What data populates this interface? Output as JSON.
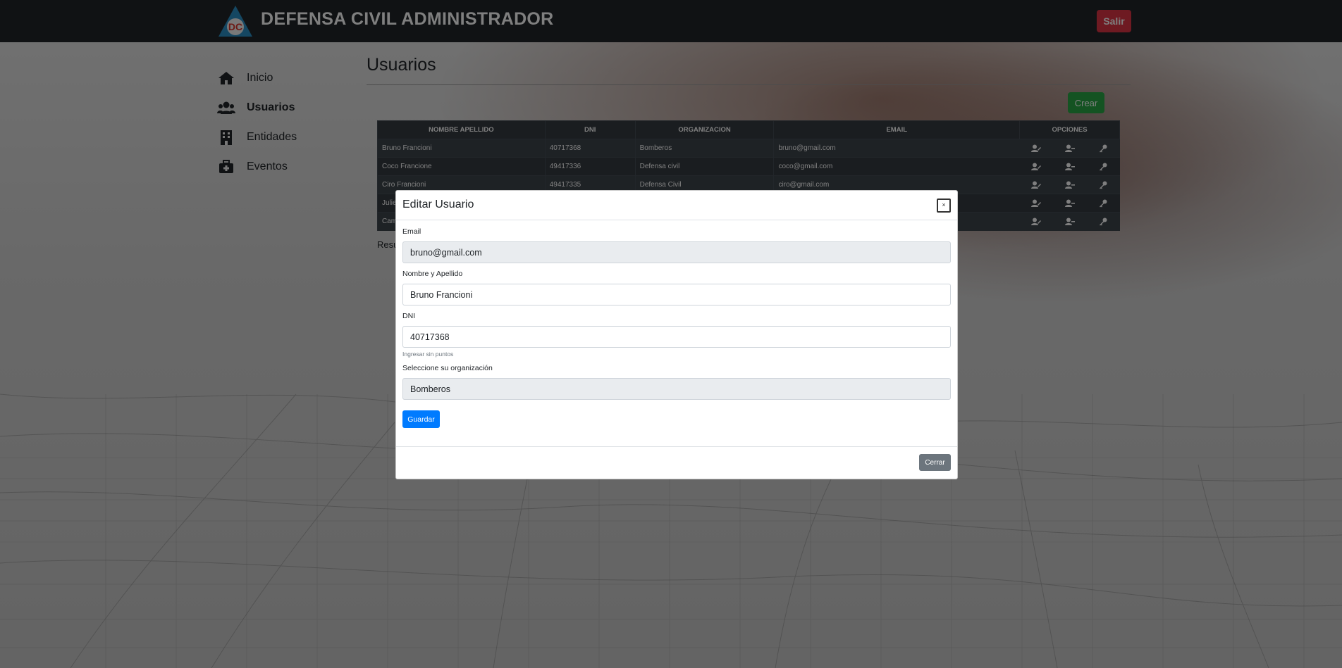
{
  "app": {
    "brand": "DEFENSA CIVIL ADMINISTRADOR",
    "logo_text": "DC",
    "logout_label": "Salir"
  },
  "sidebar": {
    "items": [
      {
        "label": "Inicio",
        "icon": "home-icon"
      },
      {
        "label": "Usuarios",
        "icon": "users-icon",
        "active": true
      },
      {
        "label": "Entidades",
        "icon": "building-icon"
      },
      {
        "label": "Eventos",
        "icon": "first-aid-icon"
      }
    ]
  },
  "main": {
    "title": "Usuarios",
    "create_label": "Crear",
    "results_text": "Resu",
    "table": {
      "headers": [
        "NOMBRE APELLIDO",
        "DNI",
        "ORGANIZACION",
        "EMAIL",
        "OPCIONES"
      ],
      "rows": [
        {
          "name": "Bruno Francioni",
          "dni": "40717368",
          "org": "Bomberos",
          "email": "bruno@gmail.com"
        },
        {
          "name": "Coco Francione",
          "dni": "49417336",
          "org": "Defensa civil",
          "email": "coco@gmail.com"
        },
        {
          "name": "Ciro Francioni",
          "dni": "49417335",
          "org": "Defensa Civil",
          "email": "ciro@gmail.com"
        },
        {
          "name": "Julie",
          "dni": "",
          "org": "",
          "email": ""
        },
        {
          "name": "Cam",
          "dni": "",
          "org": "",
          "email": ""
        }
      ]
    }
  },
  "modal": {
    "title": "Editar Usuario",
    "close_symbol": "×",
    "fields": {
      "email_label": "Email",
      "email_value": "bruno@gmail.com",
      "name_label": "Nombre y Apellido",
      "name_value": "Bruno Francioni",
      "dni_label": "DNI",
      "dni_value": "40717368",
      "dni_help": "Ingresar sin puntos",
      "org_label": "Seleccione su organización",
      "org_value": "Bomberos"
    },
    "save_label": "Guardar",
    "close_label": "Cerrar"
  },
  "colors": {
    "navbar": "#212529",
    "danger": "#dc3545",
    "success": "#28a745",
    "primary": "#007bff",
    "secondary": "#6c757d",
    "logo_blue": "#2b8fc4",
    "logo_red": "#d9342b"
  }
}
